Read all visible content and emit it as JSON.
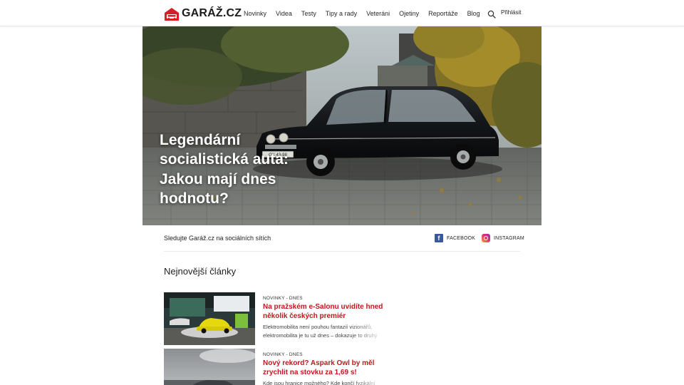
{
  "header": {
    "logo_text": "GARÁŽ.CZ",
    "nav": [
      "Novinky",
      "Videa",
      "Testy",
      "Tipy a rady",
      "Veteráni",
      "Ojetiny",
      "Reportáže",
      "Blog"
    ],
    "search_icon": "search-icon",
    "login_label": "Přihlásit"
  },
  "hero": {
    "title": "Legendární socialistická auta: Jakou mají dnes hodnotu?",
    "plate_text": "OK 43-98"
  },
  "social": {
    "text": "Sledujte Garáž.cz na sociálních sítích",
    "facebook_label": "FACEBOOK",
    "instagram_label": "INSTAGRAM",
    "facebook_color": "#3b5998"
  },
  "latest": {
    "title": "Nejnovější články",
    "articles": [
      {
        "meta": "NOVINKY - DNES",
        "headline": "Na pražském e-Salonu uvidíte hned několik českých premiér",
        "excerpt": "Elektromobilita není pouhou fantazií vizionářů, elektromobilita je tu už dnes – dokazuje to druhý"
      },
      {
        "meta": "NOVINKY - DNES",
        "headline": "Nový rekord? Aspark Owl by měl zrychlit na stovku za 1,69 s!",
        "excerpt": "Kde jsou hranice možného? Kde končí fyzikální"
      }
    ]
  },
  "colors": {
    "accent": "#c4161c",
    "brand": "#c4161c"
  }
}
